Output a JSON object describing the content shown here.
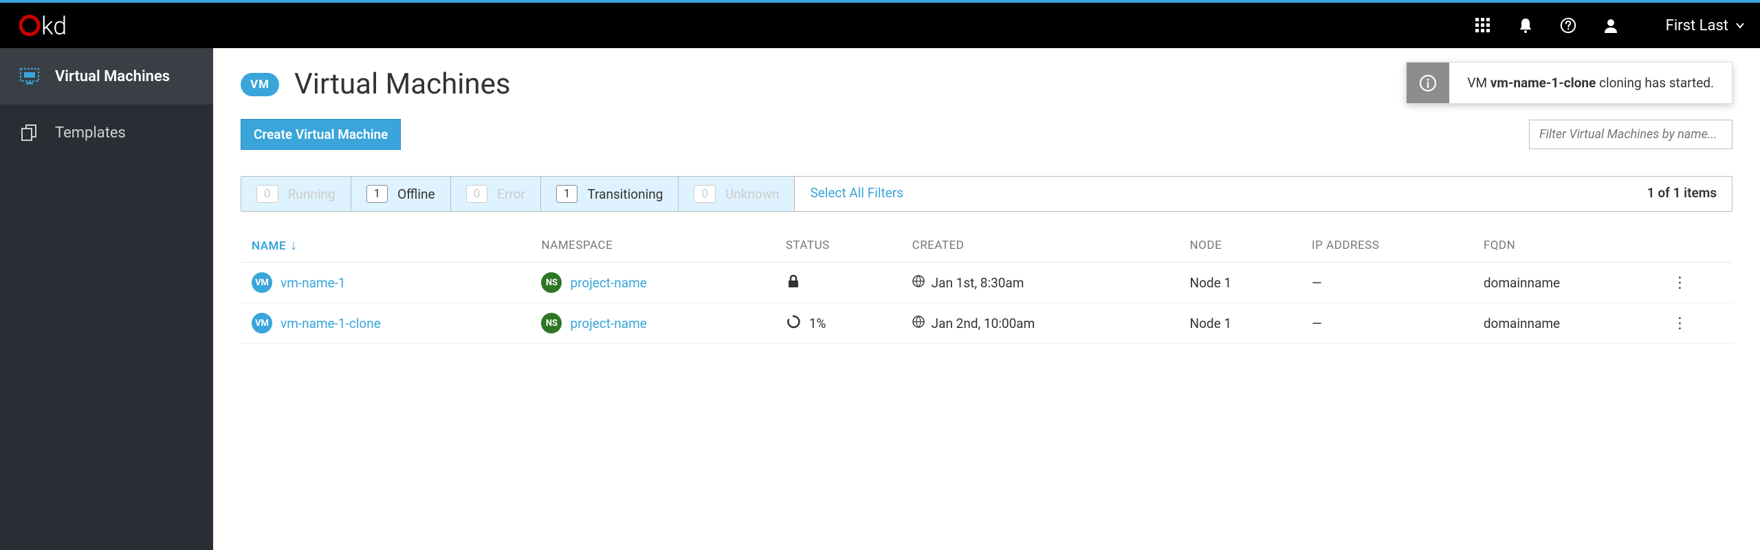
{
  "brand": "okd",
  "user_name": "First Last",
  "sidebar": {
    "items": [
      {
        "label": "Virtual Machines",
        "active": true
      },
      {
        "label": "Templates",
        "active": false
      }
    ]
  },
  "page": {
    "badge": "VM",
    "title": "Virtual Machines",
    "create_label": "Create Virtual Machine",
    "filter_placeholder": "Filter Virtual Machines by name..."
  },
  "toast": {
    "prefix": "VM ",
    "name": "vm-name-1-clone",
    "suffix": " cloning has started."
  },
  "filters": {
    "chips": [
      {
        "count": "0",
        "label": "Running",
        "dim": true
      },
      {
        "count": "1",
        "label": "Offline",
        "dim": false
      },
      {
        "count": "0",
        "label": "Error",
        "dim": true
      },
      {
        "count": "1",
        "label": "Transitioning",
        "dim": false
      },
      {
        "count": "0",
        "label": "Unknown",
        "dim": true
      }
    ],
    "select_all": "Select All Filters",
    "summary": "1 of 1 items"
  },
  "table": {
    "columns": {
      "name": "NAME",
      "namespace": "NAMESPACE",
      "status": "STATUS",
      "created": "CREATED",
      "node": "NODE",
      "ip": "IP ADDRESS",
      "fqdn": "FQDN"
    },
    "rows": [
      {
        "vm_badge": "VM",
        "name": "vm-name-1",
        "ns_badge": "NS",
        "namespace": "project-name",
        "status_kind": "locked",
        "status_text": "",
        "created": "Jan 1st, 8:30am",
        "node": "Node 1",
        "ip": "—",
        "fqdn": "domainname"
      },
      {
        "vm_badge": "VM",
        "name": "vm-name-1-clone",
        "ns_badge": "NS",
        "namespace": "project-name",
        "status_kind": "progress",
        "status_text": "1%",
        "created": "Jan 2nd, 10:00am",
        "node": "Node 1",
        "ip": "—",
        "fqdn": "domainname"
      }
    ]
  }
}
